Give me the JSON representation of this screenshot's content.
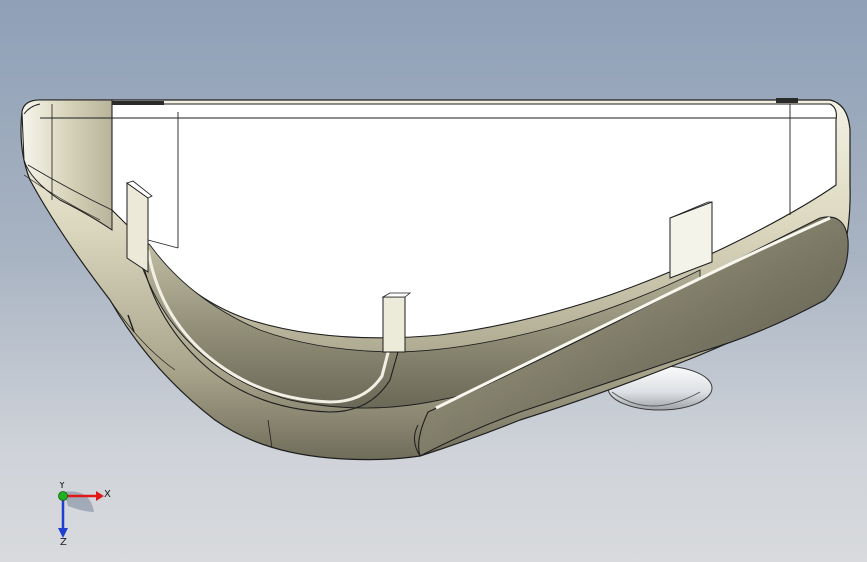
{
  "viewport": {
    "background_top": "#8fa0b7",
    "background_bottom": "#d8dadd"
  },
  "model": {
    "body_color": "#d6d2b8",
    "face_color": "#ffffff",
    "edge_color": "#1e1e1e",
    "wheel_color": "#e4e6e8"
  },
  "triad": {
    "x_label": "X",
    "y_label": "Y",
    "z_label": "Z",
    "x_color": "#e01818",
    "y_color": "#20b020",
    "z_color": "#1e3fd0"
  }
}
